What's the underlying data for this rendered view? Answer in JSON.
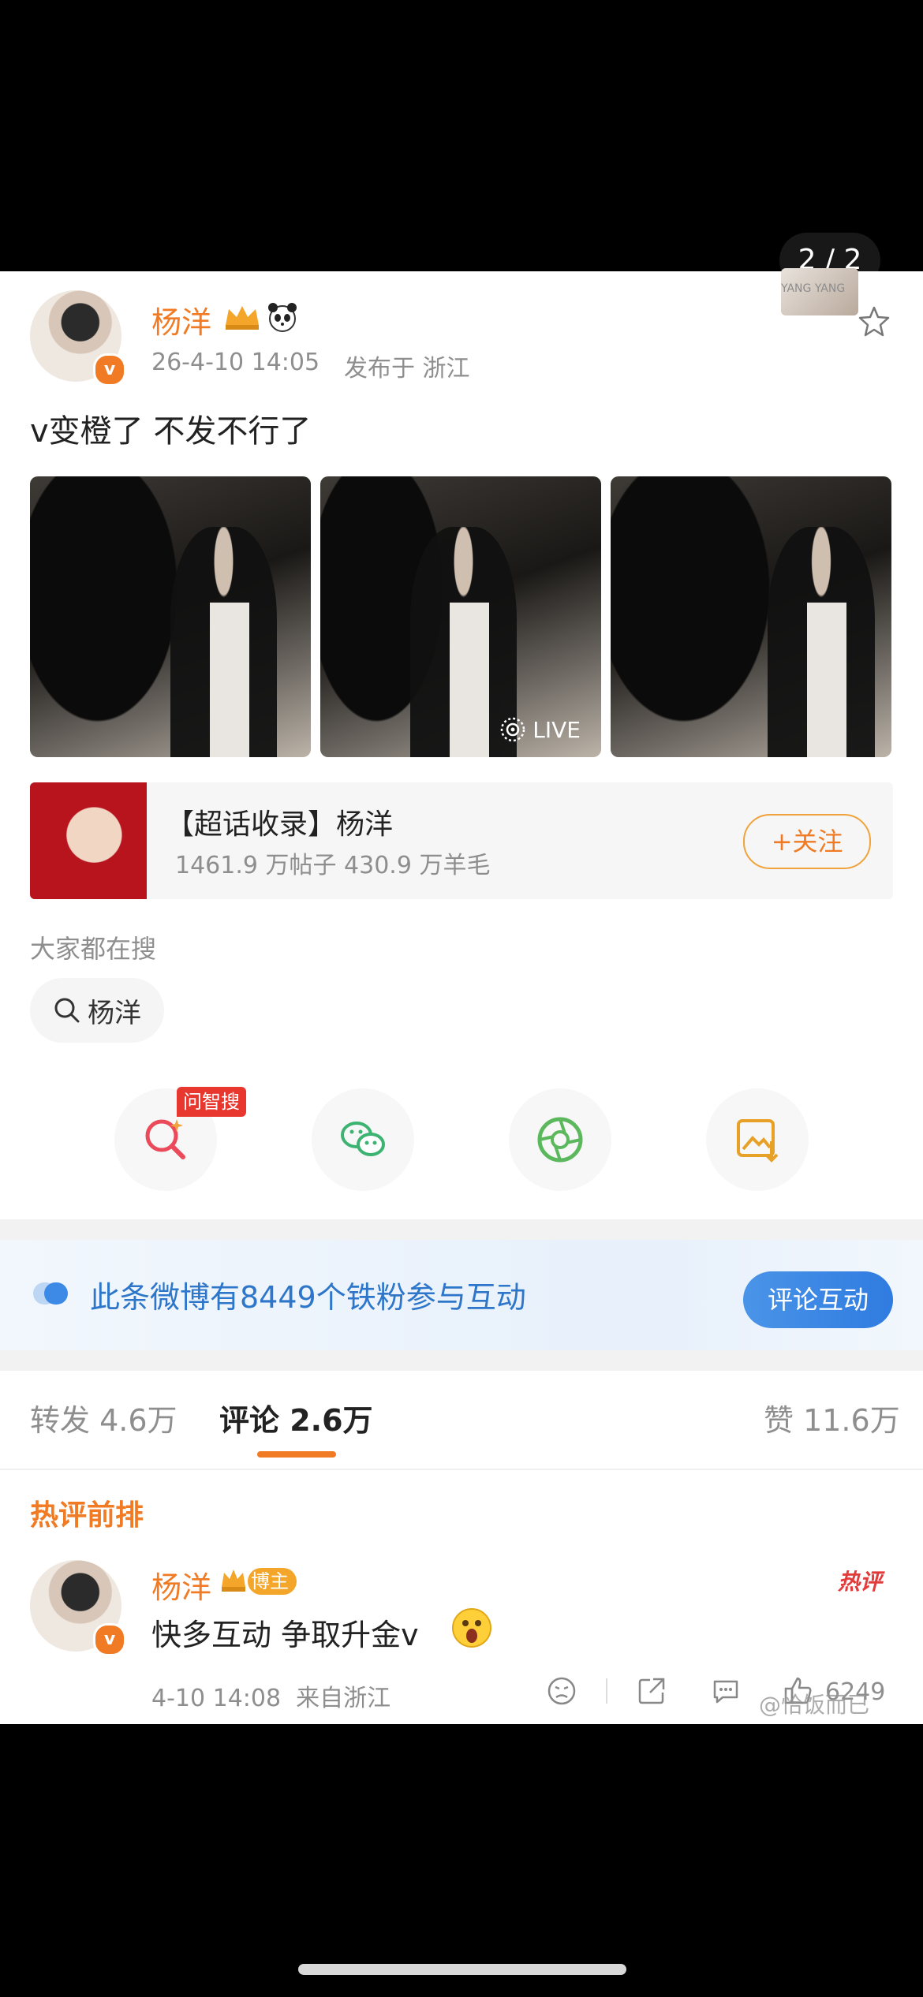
{
  "viewer": {
    "counter": "2 / 2",
    "thumb_caption": "YANG YANG"
  },
  "post": {
    "author": "杨洋",
    "meta_time": "26-4-10 14:05",
    "meta_location": "发布于 浙江",
    "text": "v变橙了 不发不行了",
    "live_label": "LIVE"
  },
  "topic_card": {
    "title": "【超话收录】杨洋",
    "stats": "1461.9 万帖子 430.9 万羊毛",
    "follow_label": "+关注"
  },
  "search": {
    "heading": "大家都在搜",
    "chip_label": "杨洋"
  },
  "share": {
    "ai_tag": "问智搜"
  },
  "fans_banner": {
    "text": "此条微博有8449个铁粉参与互动",
    "button": "评论互动"
  },
  "tabs": {
    "repost": "转发 4.6万",
    "comments": "评论 2.6万",
    "likes": "赞 11.6万"
  },
  "hot_section": {
    "title": "热评前排"
  },
  "comment": {
    "author": "杨洋",
    "badge": "博主",
    "text": "快多互动 争取升金v",
    "time_loc": "4-10 14:08  来自浙江",
    "hot_label": "热评",
    "likes": "6249",
    "watermark": "@恰饭而已"
  },
  "colors": {
    "accent": "#f07b24",
    "link_blue": "#2d76c9",
    "tag_red": "#e8372e"
  }
}
